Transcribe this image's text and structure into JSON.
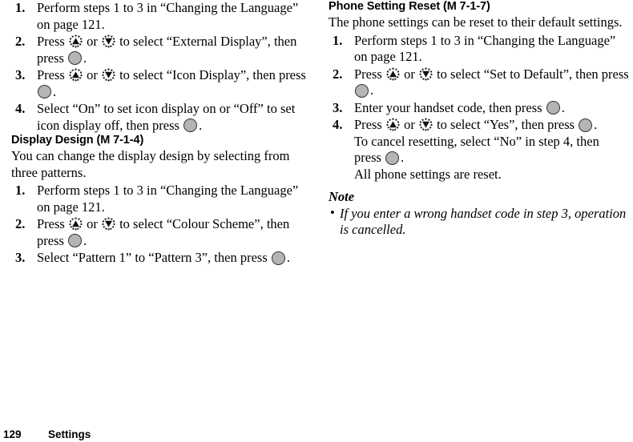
{
  "document": {
    "footer": {
      "page_number": "129",
      "chapter": "Settings"
    }
  },
  "left_column": {
    "continued_steps": [
      {
        "number": "1.",
        "text": "Perform steps 1 to 3 in “Changing the Language” on page 121."
      },
      {
        "number": "2.",
        "text_before_up": "Press ",
        "text_between": " or ",
        "text_after_down": " to select “External Display”, then press ",
        "text_end": "."
      },
      {
        "number": "3.",
        "text_before_up": "Press ",
        "text_between": " or ",
        "text_after_down": " to select “Icon Display”, then press ",
        "text_end": "."
      },
      {
        "number": "4.",
        "text_before": "Select “On” to set icon display on or “Off” to set icon display off, then press ",
        "text_end": "."
      }
    ],
    "display_design": {
      "heading": "Display Design (M 7-1-4)",
      "intro": "You can change the display design by selecting from three patterns.",
      "steps": [
        {
          "number": "1.",
          "text": "Perform steps 1 to 3 in “Changing the Language” on page 121."
        },
        {
          "number": "2.",
          "text_before_up": "Press ",
          "text_between": " or ",
          "text_after_down": " to select “Colour Scheme”, then press ",
          "text_end": "."
        },
        {
          "number": "3.",
          "text_before": "Select “Pattern 1” to “Pattern 3”, then press ",
          "text_end": "."
        }
      ]
    }
  },
  "right_column": {
    "phone_setting_reset": {
      "heading": "Phone Setting Reset (M 7-1-7)",
      "intro": "The phone settings can be reset to their default settings.",
      "steps": [
        {
          "number": "1.",
          "text": "Perform steps 1 to 3 in “Changing the Language” on page 121."
        },
        {
          "number": "2.",
          "text_before_up": "Press ",
          "text_between": " or ",
          "text_after_down": " to select “Set to Default”, then press ",
          "text_end": "."
        },
        {
          "number": "3.",
          "text_before": "Enter your handset code, then press ",
          "text_end": "."
        },
        {
          "number": "4.",
          "text_before_up": "Press ",
          "text_between": " or ",
          "text_after_down": " to select “Yes”, then press ",
          "text_end": ".",
          "sub_line_1_before": "To cancel resetting, select “No” in step 4, then press ",
          "sub_line_1_end": ".",
          "sub_line_2": "All phone settings are reset."
        }
      ],
      "note": {
        "title": "Note",
        "bullet_char": "•",
        "items": [
          "If you enter a wrong handset code in step 3, operation is cancelled."
        ]
      }
    }
  },
  "icons": {
    "up_key": "navigation-up-key-icon",
    "down_key": "navigation-down-key-icon",
    "center_key": "center-select-key-icon"
  },
  "colors": {
    "text": "#000000",
    "page_background": "#ffffff",
    "key_fill": "#b5b5b5",
    "key_stroke": "#333333"
  }
}
